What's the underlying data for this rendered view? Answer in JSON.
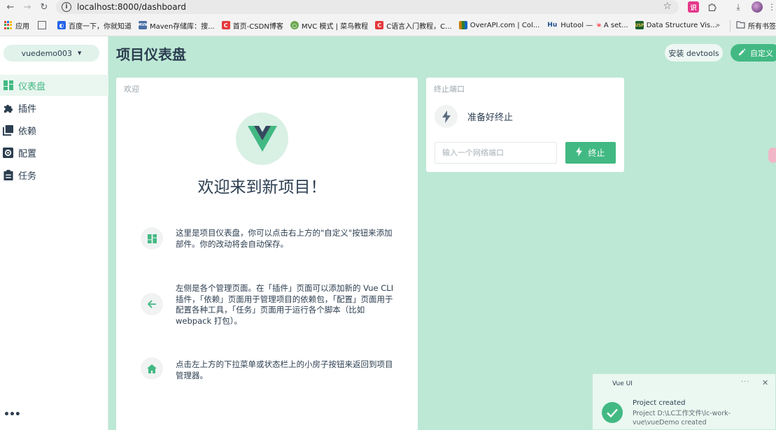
{
  "browser": {
    "url": "localhost:8000/dashboard",
    "bookmarks": [
      {
        "label": "应用",
        "icon": "apps-grid-icon"
      },
      {
        "label": "百度一下，你就知道",
        "icon": "baidu-icon",
        "color": "#2563eb"
      },
      {
        "label": "Maven存储库：搜...",
        "icon": "mvn-icon",
        "color": "#4a6fa5"
      },
      {
        "label": "首页-CSDN博客",
        "icon": "csdn-icon",
        "color": "#e4393c"
      },
      {
        "label": "MVC 模式 | 菜鸟教程",
        "icon": "runoob-icon",
        "color": "#6aa84f"
      },
      {
        "label": "C语言入门教程，C...",
        "icon": "c-icon",
        "color": "#e4393c"
      },
      {
        "label": "OverAPI.com | Col...",
        "icon": "overapi-icon",
        "color": "#c27c0e"
      },
      {
        "label": "Hutool — 🍬A set...",
        "icon": "hutool-icon",
        "color": "#1f4e8c"
      },
      {
        "label": "Data Structure Vis...",
        "icon": "usf-icon",
        "color": "#1d5e2e"
      }
    ],
    "more_bookmarks": "所有书签"
  },
  "sidebar": {
    "project": "vuedemo003",
    "items": [
      {
        "label": "仪表盘",
        "icon": "dashboard-icon",
        "active": true
      },
      {
        "label": "插件",
        "icon": "puzzle-icon",
        "active": false
      },
      {
        "label": "依赖",
        "icon": "library-icon",
        "active": false
      },
      {
        "label": "配置",
        "icon": "settings-icon",
        "active": false
      },
      {
        "label": "任务",
        "icon": "clipboard-icon",
        "active": false
      }
    ],
    "more": "•••"
  },
  "header": {
    "title": "项目仪表盘",
    "devtools_label": "安装 devtools",
    "customize_label": "自定义"
  },
  "welcome": {
    "title": "欢迎",
    "heading": "欢迎来到新项目！",
    "tips": [
      {
        "icon": "dashboard-icon",
        "text": "这里是项目仪表盘，你可以点击右上方的\"自定义\"按钮来添加部件。你的改动将会自动保存。"
      },
      {
        "icon": "arrow-left-icon",
        "text": "左侧是各个管理页面。在「插件」页面可以添加新的 Vue CLI 插件，「依赖」页面用于管理项目的依赖包，「配置」页面用于配置各种工具，「任务」页面用于运行各个脚本（比如 webpack 打包）。"
      },
      {
        "icon": "home-icon",
        "text": "点击左上方的下拉菜单或状态栏上的小房子按钮来返回到项目管理器。"
      }
    ]
  },
  "kill_port": {
    "title": "终止端口",
    "status": "准备好终止",
    "input_placeholder": "输入一个网络端口",
    "button_label": "终止"
  },
  "notification": {
    "source": "Vue UI",
    "more": "···",
    "close": "✕",
    "title": "Project created",
    "body": "Project D:\\LC工作文件\\lc-work-vue\\vueDemo created"
  },
  "colors": {
    "accent": "#42b983",
    "main_bg": "#bde8d5",
    "vue_dark": "#35495e"
  }
}
